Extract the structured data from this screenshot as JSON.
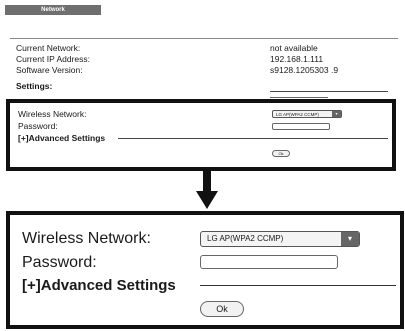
{
  "header": {
    "tab_label": "Network"
  },
  "info": {
    "current_network_label": "Current Network:",
    "current_network_value": "not available",
    "ip_label": "Current IP Address:",
    "ip_value": "192.168.1.111",
    "software_label": "Software Version:",
    "software_value": "s9128.1205303 .9",
    "settings_label": "Settings:"
  },
  "settings": {
    "wireless_label": "Wireless Network:",
    "wireless_selected": "LG AP(WPA2 CCMP)",
    "password_label": "Password:",
    "password_value": "",
    "advanced_label": "[+]Advanced Settings",
    "ok_label": "Ok"
  },
  "icons": {
    "dropdown": "triangle-down-icon",
    "arrow": "arrow-down-icon"
  }
}
